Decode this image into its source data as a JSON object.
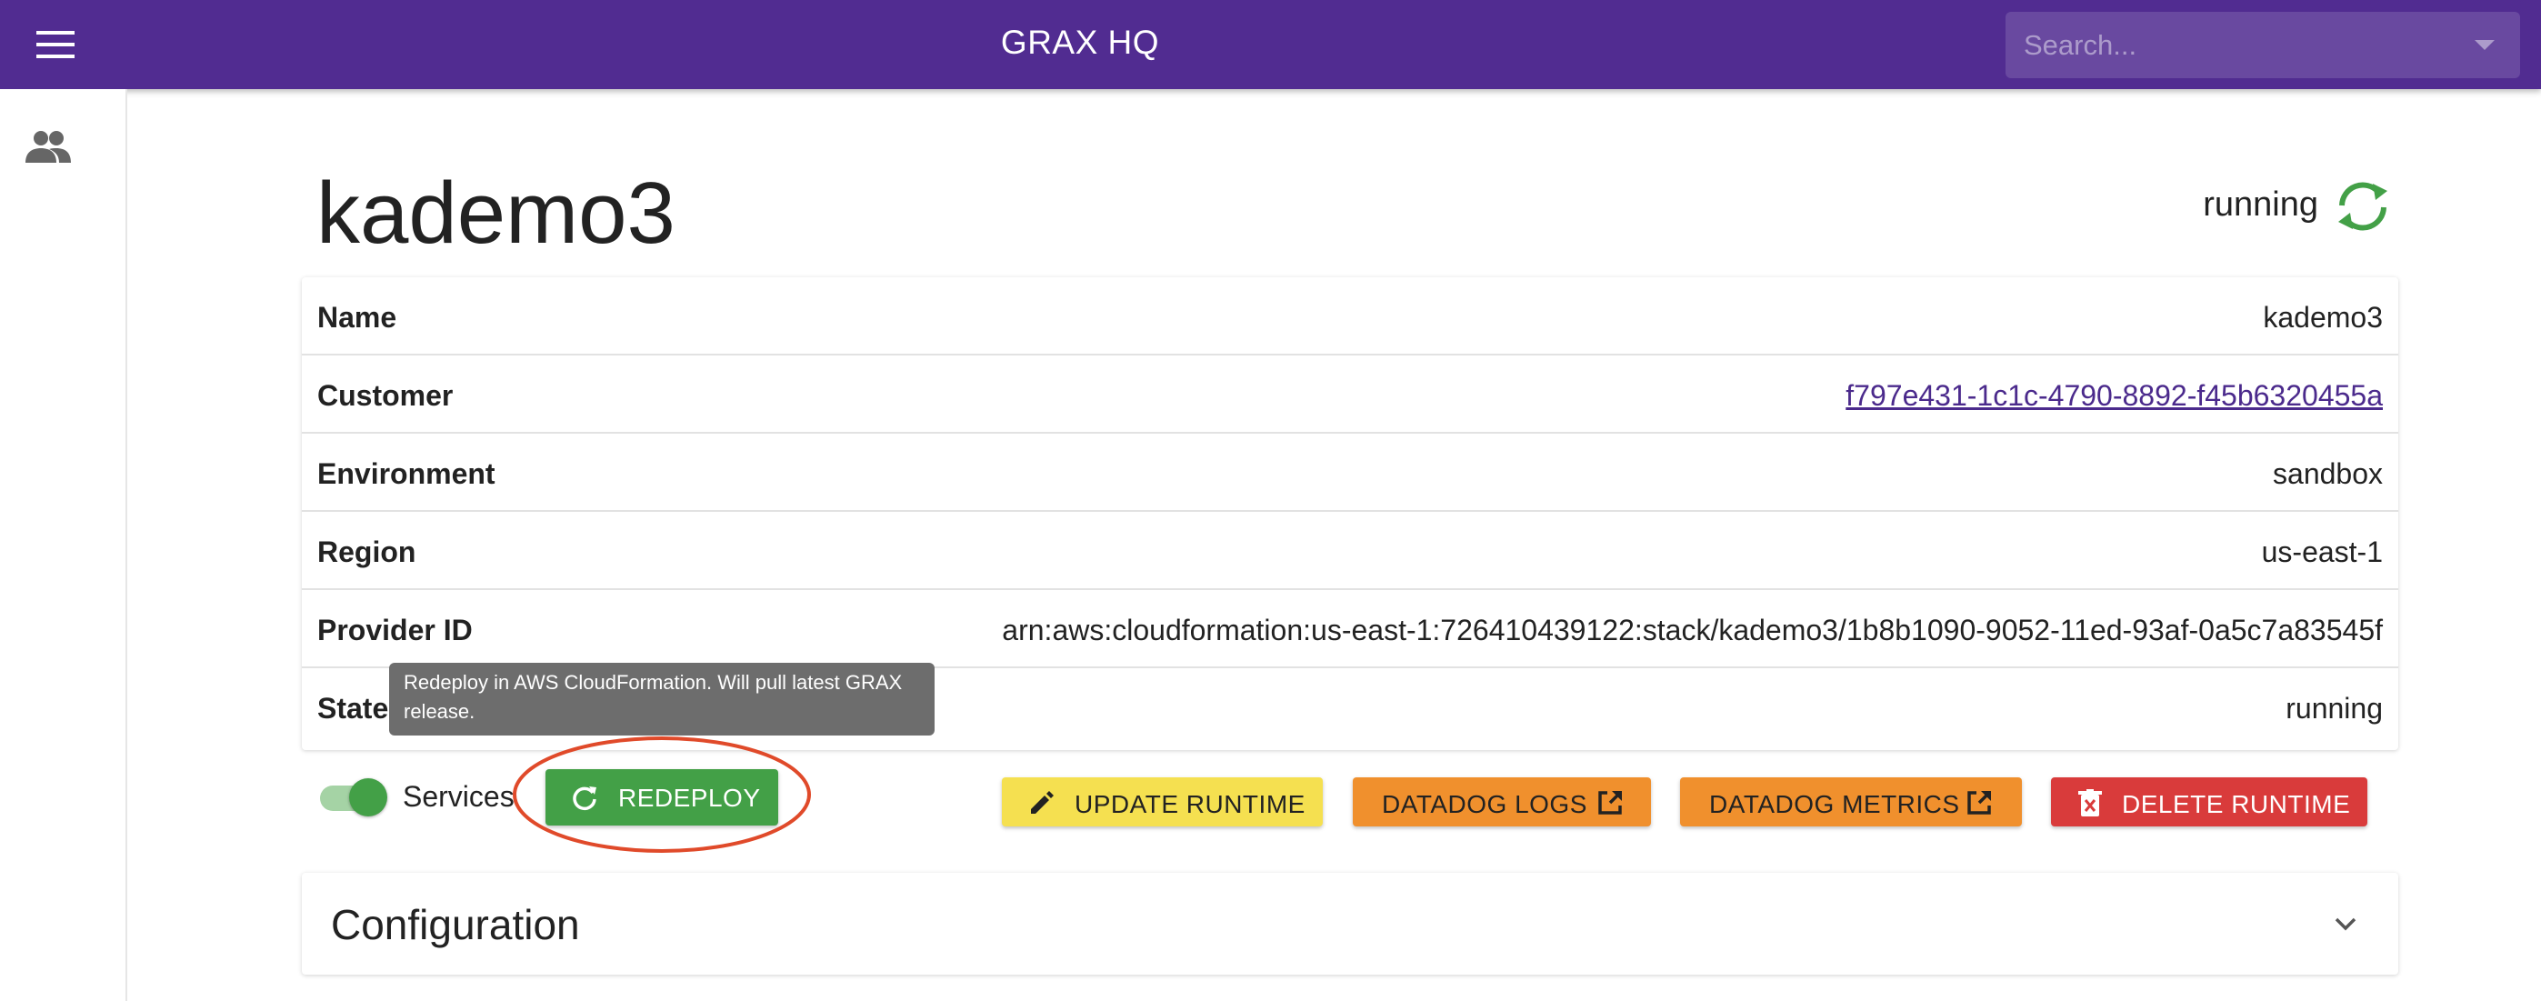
{
  "app": {
    "title": "GRAX HQ",
    "brand_color": "#512c91"
  },
  "search": {
    "placeholder": "Search...",
    "value": ""
  },
  "sidebar": {
    "items": [
      {
        "icon": "people-icon"
      }
    ]
  },
  "header": {
    "title": "kademo3",
    "status": "running",
    "status_icon": "sync-icon",
    "status_color": "#43a047"
  },
  "details": {
    "rows": [
      {
        "label": "Name",
        "value": "kademo3"
      },
      {
        "label": "Customer",
        "value": "f797e431-1c1c-4790-8892-f45b6320455a"
      },
      {
        "label": "Environment",
        "value": "sandbox"
      },
      {
        "label": "Region",
        "value": "us-east-1"
      },
      {
        "label": "Provider ID",
        "value": "arn:aws:cloudformation:us-east-1:726410439122:stack/kademo3/1b8b1090-9052-11ed-93af-0a5c7a83545f"
      },
      {
        "label": "State",
        "value": "running"
      }
    ]
  },
  "tooltip": {
    "text": "Redeploy in AWS CloudFormation. Will pull latest GRAX release."
  },
  "services_toggle": {
    "label": "Services",
    "on": true
  },
  "actions": {
    "redeploy": {
      "label": "REDEPLOY",
      "icon": "refresh-icon",
      "color": "#43a047"
    },
    "update_runtime": {
      "label": "UPDATE RUNTIME",
      "icon": "pencil-icon",
      "color": "#f5e050"
    },
    "datadog_logs": {
      "label": "DATADOG LOGS",
      "icon": "external-link-icon",
      "color": "#f0902d"
    },
    "datadog_metrics": {
      "label": "DATADOG METRICS",
      "icon": "external-link-icon",
      "color": "#f0902d"
    },
    "delete_runtime": {
      "label": "DELETE RUNTIME",
      "icon": "trash-icon",
      "color": "#d93b3b"
    }
  },
  "configuration": {
    "title": "Configuration",
    "expanded": false
  }
}
